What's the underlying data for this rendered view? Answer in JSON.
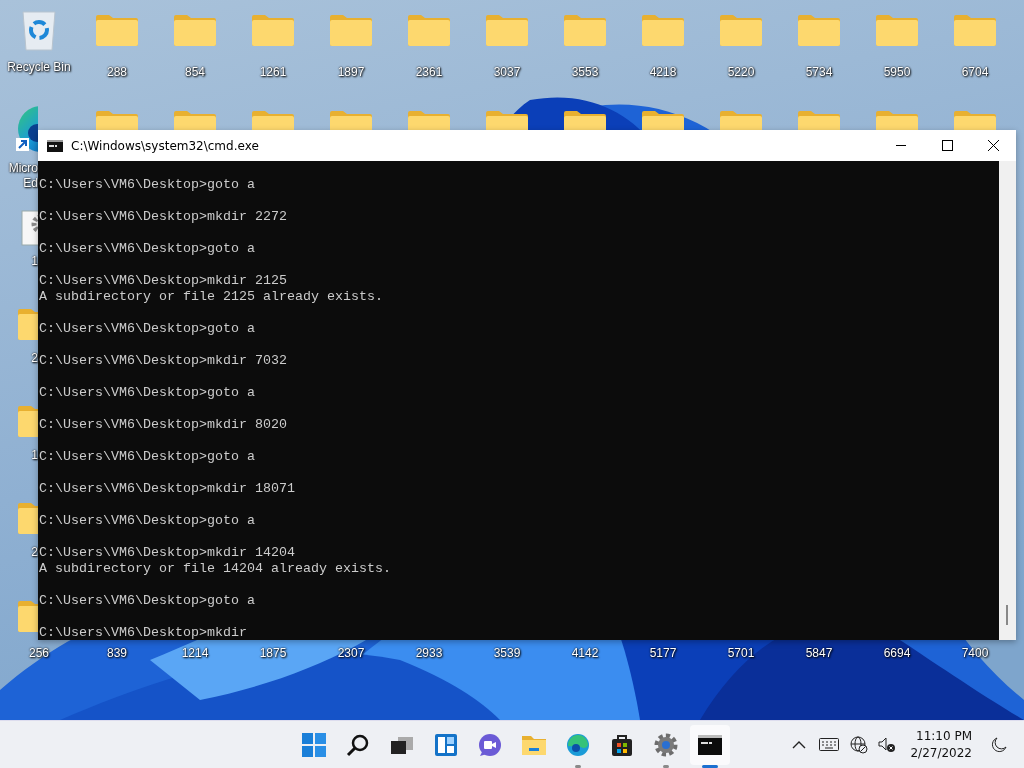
{
  "desktop": {
    "top_row": [
      {
        "kind": "recycle-bin",
        "label": "Recycle Bin"
      },
      {
        "kind": "folder",
        "label": "288"
      },
      {
        "kind": "folder",
        "label": "854"
      },
      {
        "kind": "folder",
        "label": "1261"
      },
      {
        "kind": "folder",
        "label": "1897"
      },
      {
        "kind": "folder",
        "label": "2361"
      },
      {
        "kind": "folder",
        "label": "3037"
      },
      {
        "kind": "folder",
        "label": "3553"
      },
      {
        "kind": "folder",
        "label": "4218"
      },
      {
        "kind": "folder",
        "label": "5220"
      },
      {
        "kind": "folder",
        "label": "5734"
      },
      {
        "kind": "folder",
        "label": "5950"
      },
      {
        "kind": "folder",
        "label": "6704"
      }
    ],
    "second_row": [
      {
        "kind": "folder"
      },
      {
        "kind": "folder"
      },
      {
        "kind": "folder"
      },
      {
        "kind": "folder"
      },
      {
        "kind": "folder"
      },
      {
        "kind": "folder"
      },
      {
        "kind": "folder"
      },
      {
        "kind": "folder"
      },
      {
        "kind": "folder"
      },
      {
        "kind": "folder"
      },
      {
        "kind": "folder"
      },
      {
        "kind": "folder"
      }
    ],
    "left_column": [
      {
        "kind": "edge",
        "label_lines": [
          "Micro",
          "Ed"
        ]
      },
      {
        "kind": "app",
        "label_lines": [
          "1"
        ]
      },
      {
        "kind": "folder",
        "label_lines": [
          "2"
        ]
      },
      {
        "kind": "folder",
        "label_lines": [
          "1"
        ]
      },
      {
        "kind": "folder",
        "label_lines": [
          "2"
        ]
      },
      {
        "kind": "folder"
      }
    ],
    "bottom_row_labels": [
      "256",
      "839",
      "1214",
      "1875",
      "2307",
      "2933",
      "3539",
      "4142",
      "5177",
      "5701",
      "5847",
      "6694",
      "7400"
    ]
  },
  "window": {
    "title": "C:\\Windows\\system32\\cmd.exe",
    "console_blocks": [
      [
        "C:\\Users\\VM6\\Desktop>goto a"
      ],
      [
        "C:\\Users\\VM6\\Desktop>mkdir 2272"
      ],
      [
        "C:\\Users\\VM6\\Desktop>goto a"
      ],
      [
        "C:\\Users\\VM6\\Desktop>mkdir 2125",
        "A subdirectory or file 2125 already exists."
      ],
      [
        "C:\\Users\\VM6\\Desktop>goto a"
      ],
      [
        "C:\\Users\\VM6\\Desktop>mkdir 7032"
      ],
      [
        "C:\\Users\\VM6\\Desktop>goto a"
      ],
      [
        "C:\\Users\\VM6\\Desktop>mkdir 8020"
      ],
      [
        "C:\\Users\\VM6\\Desktop>goto a"
      ],
      [
        "C:\\Users\\VM6\\Desktop>mkdir 18071"
      ],
      [
        "C:\\Users\\VM6\\Desktop>goto a"
      ],
      [
        "C:\\Users\\VM6\\Desktop>mkdir 14204",
        "A subdirectory or file 14204 already exists."
      ],
      [
        "C:\\Users\\VM6\\Desktop>goto a"
      ],
      [
        "C:\\Users\\VM6\\Desktop>mkdir"
      ]
    ]
  },
  "taskbar": {
    "apps": [
      {
        "kind": "start",
        "running": false,
        "active": false
      },
      {
        "kind": "search",
        "running": false,
        "active": false
      },
      {
        "kind": "task-view",
        "running": false,
        "active": false
      },
      {
        "kind": "widgets",
        "running": false,
        "active": false
      },
      {
        "kind": "chat",
        "running": false,
        "active": false
      },
      {
        "kind": "explorer",
        "running": false,
        "active": false
      },
      {
        "kind": "edge",
        "running": true,
        "active": false
      },
      {
        "kind": "store",
        "running": false,
        "active": false
      },
      {
        "kind": "settings",
        "running": true,
        "active": false
      },
      {
        "kind": "terminal",
        "running": true,
        "active": true
      }
    ],
    "time": "11:10 PM",
    "date": "2/27/2022"
  }
}
